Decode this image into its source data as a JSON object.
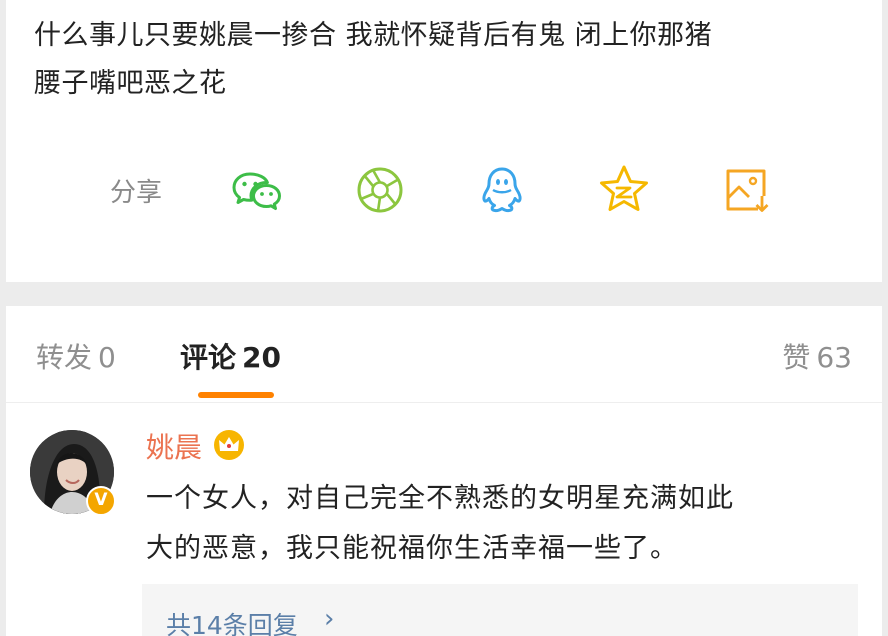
{
  "post": {
    "text_line1": "什么事儿只要姚晨一掺合 我就怀疑背后有鬼 闭上你那猪",
    "text_line2": "腰子嘴吧恶之花"
  },
  "share": {
    "label": "分享",
    "icons": [
      {
        "name": "wechat-icon",
        "color": "#3dbd48"
      },
      {
        "name": "moments-icon",
        "color": "#8cc63f"
      },
      {
        "name": "qq-icon",
        "color": "#3aa5ea"
      },
      {
        "name": "qzone-icon",
        "color": "#f5b800"
      },
      {
        "name": "save-image-icon",
        "color": "#f5a623"
      }
    ]
  },
  "tabs": {
    "repost": {
      "label": "转发",
      "count": "0"
    },
    "comments": {
      "label": "评论",
      "count": "20"
    },
    "likes": {
      "label": "赞",
      "count": "63"
    }
  },
  "comment": {
    "username": "姚晨",
    "text_line1": "一个女人，对自己完全不熟悉的女明星充满如此",
    "text_line2": "大的恶意，我只能祝福你生活幸福一些了。",
    "replies_link": "共14条回复",
    "replies_chevron": "›",
    "verified_badge_mark": "V"
  },
  "colors": {
    "accent": "#ff8200",
    "username": "#eb7350",
    "link": "#5b7fa8"
  }
}
